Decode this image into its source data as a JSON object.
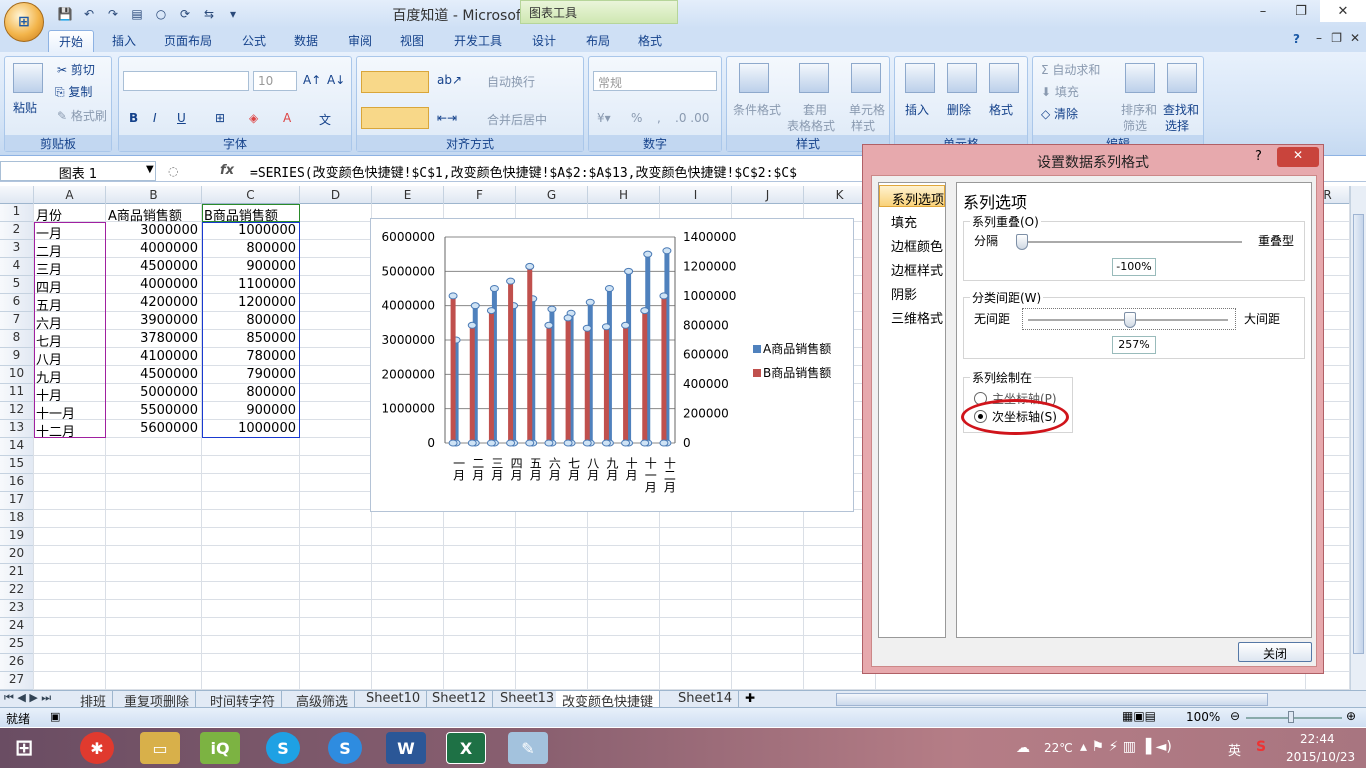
{
  "window": {
    "title": "百度知道 - Microsoft Excel",
    "chart_tools_label": "图表工具"
  },
  "tabs": [
    "开始",
    "插入",
    "页面布局",
    "公式",
    "数据",
    "审阅",
    "视图",
    "开发工具",
    "设计",
    "布局",
    "格式"
  ],
  "ribbon": {
    "clipboard": {
      "paste": "粘贴",
      "cut": "剪切",
      "copy": "复制",
      "format_painter": "格式刷",
      "label": "剪贴板"
    },
    "font": {
      "size": "10",
      "label": "字体",
      "bold": "B",
      "italic": "I",
      "underline": "U"
    },
    "alignment": {
      "wrap": "自动换行",
      "merge": "合并后居中",
      "label": "对齐方式"
    },
    "number": {
      "format": "常规",
      "percent": "%",
      "comma": ",",
      "label": "数字"
    },
    "styles": {
      "conditional": "条件格式",
      "table1": "套用",
      "table2": "表格格式",
      "cell1": "单元格",
      "cell2": "样式",
      "label": "样式"
    },
    "cells": {
      "insert": "插入",
      "delete": "删除",
      "format": "格式",
      "label": "单元格"
    },
    "editing": {
      "autosum": "自动求和",
      "fill": "填充",
      "clear": "清除",
      "sort1": "排序和",
      "sort2": "筛选",
      "find1": "查找和",
      "find2": "选择",
      "label": "编辑"
    }
  },
  "formula_bar": {
    "name_box": "图表 1",
    "fx": "fx",
    "formula": "=SERIES(改变颜色快捷键!$C$1,改变颜色快捷键!$A$2:$A$13,改变颜色快捷键!$C$2:$C$"
  },
  "columns": [
    "A",
    "B",
    "C",
    "D",
    "E",
    "F",
    "G",
    "H",
    "I",
    "J",
    "K",
    "R"
  ],
  "rows": [
    "1",
    "2",
    "3",
    "4",
    "5",
    "6",
    "7",
    "8",
    "9",
    "10",
    "11",
    "12",
    "13",
    "14",
    "15",
    "16",
    "17",
    "18",
    "19",
    "20",
    "21",
    "22",
    "23",
    "24",
    "25",
    "26",
    "27"
  ],
  "sheet": {
    "headers": [
      "月份",
      "A商品销售额",
      "B商品销售额"
    ],
    "data": [
      [
        "一月",
        "3000000",
        "1000000"
      ],
      [
        "二月",
        "4000000",
        "800000"
      ],
      [
        "三月",
        "4500000",
        "900000"
      ],
      [
        "四月",
        "4000000",
        "1100000"
      ],
      [
        "五月",
        "4200000",
        "1200000"
      ],
      [
        "六月",
        "3900000",
        "800000"
      ],
      [
        "七月",
        "3780000",
        "850000"
      ],
      [
        "八月",
        "4100000",
        "780000"
      ],
      [
        "九月",
        "4500000",
        "790000"
      ],
      [
        "十月",
        "5000000",
        "800000"
      ],
      [
        "十一月",
        "5500000",
        "900000"
      ],
      [
        "十二月",
        "5600000",
        "1000000"
      ]
    ]
  },
  "chart_data": {
    "type": "bar",
    "categories": [
      "一月",
      "二月",
      "三月",
      "四月",
      "五月",
      "六月",
      "七月",
      "八月",
      "九月",
      "十月",
      "十一月",
      "十二月"
    ],
    "series": [
      {
        "name": "A商品销售额",
        "axis": "primary",
        "color": "#4f81bd",
        "values": [
          3000000,
          4000000,
          4500000,
          4000000,
          4200000,
          3900000,
          3780000,
          4100000,
          4500000,
          5000000,
          5500000,
          5600000
        ]
      },
      {
        "name": "B商品销售额",
        "axis": "secondary",
        "color": "#c0504d",
        "values": [
          1000000,
          800000,
          900000,
          1100000,
          1200000,
          800000,
          850000,
          780000,
          790000,
          800000,
          900000,
          1000000
        ]
      }
    ],
    "ylim": [
      0,
      6000000
    ],
    "y2lim": [
      0,
      1400000
    ],
    "yticks": [
      "6000000",
      "5000000",
      "4000000",
      "3000000",
      "2000000",
      "1000000",
      "0"
    ],
    "y2ticks": [
      "1400000",
      "1200000",
      "1000000",
      "800000",
      "600000",
      "400000",
      "200000",
      "0"
    ],
    "legend": "right",
    "grid": true
  },
  "dialog": {
    "title": "设置数据系列格式",
    "help": "?",
    "close_x": "✕",
    "nav": [
      "系列选项",
      "填充",
      "边框颜色",
      "边框样式",
      "阴影",
      "三维格式"
    ],
    "section_title": "系列选项",
    "overlap": {
      "legend": "系列重叠(O)",
      "left": "分隔",
      "right": "重叠型",
      "value": "-100%"
    },
    "gap": {
      "legend": "分类间距(W)",
      "left": "无间距",
      "right": "大间距",
      "value": "257%"
    },
    "plot_on": {
      "legend": "系列绘制在",
      "primary": "主坐标轴(P)",
      "secondary": "次坐标轴(S)"
    },
    "close_button": "关闭"
  },
  "sheet_tabs": [
    "排班",
    "重复项删除",
    "时间转字符",
    "高级筛选",
    "Sheet10",
    "Sheet12",
    "Sheet13",
    "改变颜色快捷键",
    "Sheet14"
  ],
  "status": {
    "ready": "就绪",
    "zoom": "100%"
  },
  "taskbar": {
    "weather": "22℃",
    "ime": "英",
    "time": "22:44",
    "date": "2015/10/23"
  }
}
